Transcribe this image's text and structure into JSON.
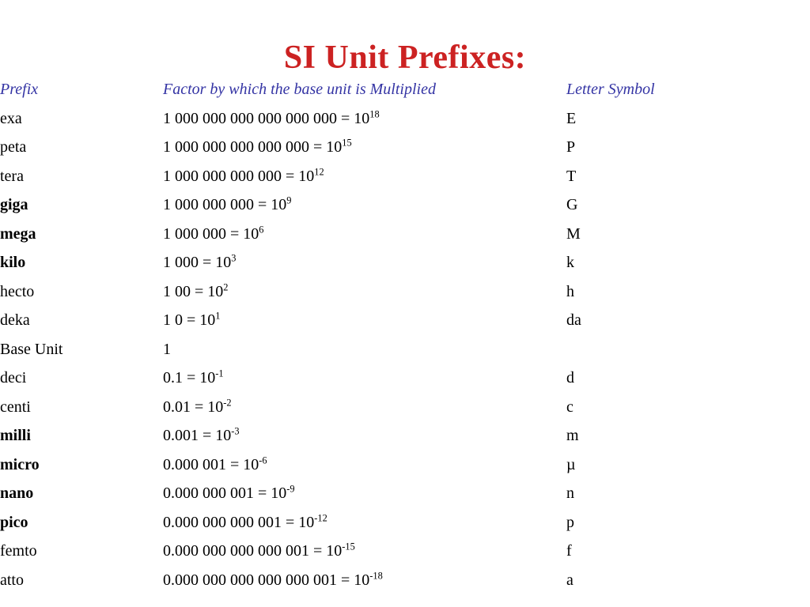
{
  "title": "SI Unit Prefixes:",
  "colors": {
    "title": "#CC2222",
    "header": "#3434A4",
    "body_text": "#000000",
    "background": "#FFFFFF"
  },
  "table": {
    "headers": {
      "prefix": "Prefix",
      "factor": "Factor by which the base unit is Multiplied",
      "symbol": "Letter Symbol"
    },
    "rows": [
      {
        "prefix": "exa",
        "bold": false,
        "factor_number": "1 000 000 000 000 000 000",
        "factor_eq": " = 10",
        "exponent": "18",
        "symbol": "E"
      },
      {
        "prefix": "peta",
        "bold": false,
        "factor_number": "1 000 000 000 000 000",
        "factor_eq": " = 10",
        "exponent": "15",
        "symbol": "P"
      },
      {
        "prefix": "tera",
        "bold": false,
        "factor_number": "1 000 000 000 000",
        "factor_eq": " = 10",
        "exponent": "12",
        "symbol": "T"
      },
      {
        "prefix": "giga",
        "bold": true,
        "factor_number": "1 000 000 000",
        "factor_eq": " = 10",
        "exponent": "9",
        "symbol": "G"
      },
      {
        "prefix": "mega",
        "bold": true,
        "factor_number": "1 000 000",
        "factor_eq": " = 10",
        "exponent": "6",
        "symbol": "M"
      },
      {
        "prefix": "kilo",
        "bold": true,
        "factor_number": "1 000",
        "factor_eq": " = 10",
        "exponent": "3",
        "symbol": "k"
      },
      {
        "prefix": "hecto",
        "bold": false,
        "factor_number": "1 00",
        "factor_eq": " = 10",
        "exponent": "2",
        "symbol": "h"
      },
      {
        "prefix": "deka",
        "bold": false,
        "factor_number": "1 0",
        "factor_eq": " = 10",
        "exponent": "1",
        "symbol": "da"
      },
      {
        "prefix": "Base Unit",
        "bold": false,
        "factor_number": "1",
        "factor_eq": "",
        "exponent": "",
        "symbol": ""
      },
      {
        "prefix": "deci",
        "bold": false,
        "factor_number": "0.1",
        "factor_eq": " = 10",
        "exponent": "-1",
        "symbol": "d"
      },
      {
        "prefix": "centi",
        "bold": false,
        "factor_number": "0.01",
        "factor_eq": " = 10",
        "exponent": "-2",
        "symbol": "c"
      },
      {
        "prefix": "milli",
        "bold": true,
        "factor_number": "0.001",
        "factor_eq": " = 10",
        "exponent": "-3",
        "symbol": "m"
      },
      {
        "prefix": "micro",
        "bold": true,
        "factor_number": "0.000 001",
        "factor_eq": " = 10",
        "exponent": "-6",
        "symbol": "µ"
      },
      {
        "prefix": "nano",
        "bold": true,
        "factor_number": "0.000 000 001",
        "factor_eq": " = 10",
        "exponent": "-9",
        "symbol": "n"
      },
      {
        "prefix": "pico",
        "bold": true,
        "factor_number": "0.000 000 000 001",
        "factor_eq": " = 10",
        "exponent": "-12",
        "symbol": "p"
      },
      {
        "prefix": "femto",
        "bold": false,
        "factor_number": "0.000 000 000 000 001",
        "factor_eq": " = 10",
        "exponent": "-15",
        "symbol": "f"
      },
      {
        "prefix": "atto",
        "bold": false,
        "factor_number": "0.000 000 000 000 000 001",
        "factor_eq": " = 10",
        "exponent": "-18",
        "symbol": "a"
      }
    ]
  }
}
